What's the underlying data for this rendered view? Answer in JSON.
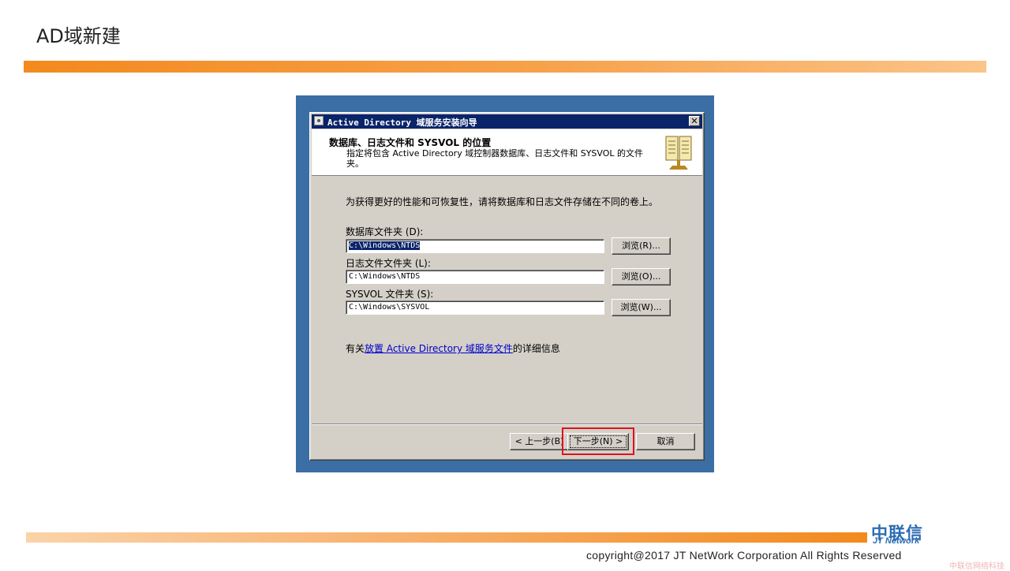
{
  "slide": {
    "title": "AD域新建",
    "copyright": "copyright@2017  JT NetWork Corporation All Rights Reserved",
    "logo_cn": "中联信",
    "logo_en": "JT Network",
    "watermark": "中联信网络科技"
  },
  "dialog": {
    "window_title": "Active Directory 域服务安装向导",
    "header_title": "数据库、日志文件和 SYSVOL 的位置",
    "header_desc": "指定将包含 Active Directory 域控制器数据库、日志文件和 SYSVOL 的文件夹。",
    "intro_text": "为获得更好的性能和可恢复性，请将数据库和日志文件存储在不同的卷上。",
    "fields": [
      {
        "label": "数据库文件夹 (D):",
        "value": "C:\\Windows\\NTDS",
        "browse": "浏览(R)..."
      },
      {
        "label": "日志文件文件夹 (L):",
        "value": "C:\\Windows\\NTDS",
        "browse": "浏览(O)..."
      },
      {
        "label": "SYSVOL 文件夹 (S):",
        "value": "C:\\Windows\\SYSVOL",
        "browse": "浏览(W)..."
      }
    ],
    "more_info_prefix": "有关",
    "more_info_link": "放置 Active Directory 域服务文件",
    "more_info_suffix": "的详细信息",
    "buttons": {
      "back": "< 上一步(B)",
      "next": "下一步(N) >",
      "cancel": "取消"
    },
    "close_glyph": "✕",
    "colors": {
      "desktop": "#3a6ea5",
      "titlebar": "#0a246a",
      "dialog_face": "#d4d0c8",
      "highlight_box": "#e0121c",
      "link": "#0000cc"
    }
  }
}
